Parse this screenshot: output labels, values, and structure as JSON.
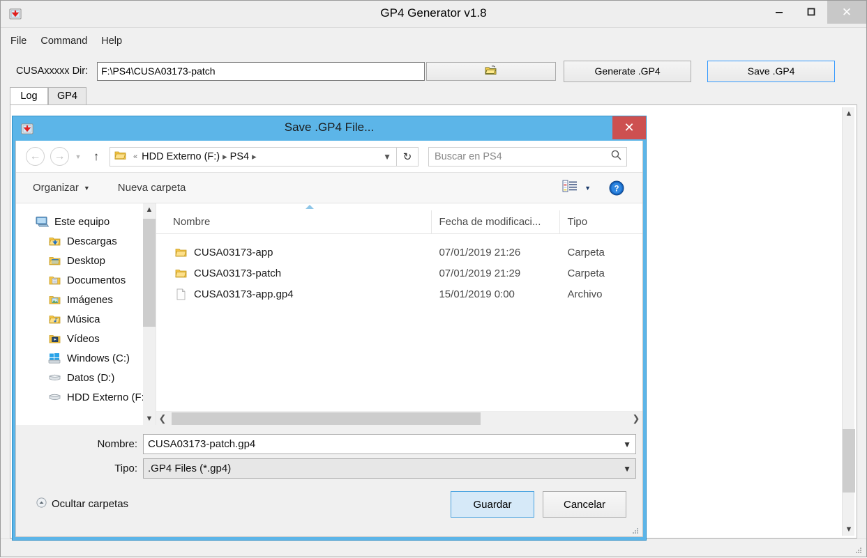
{
  "app": {
    "title": "GP4 Generator v1.8",
    "icon": "save-arrow-icon",
    "window_buttons": {
      "minimize": "—",
      "maximize": "❐",
      "close": "✕"
    },
    "menubar": [
      "File",
      "Command",
      "Help"
    ],
    "path_row": {
      "label": "CUSAxxxxx Dir:",
      "value": "F:\\PS4\\CUSA03173-patch",
      "browse_icon": "open-folder-icon",
      "generate_label": "Generate .GP4",
      "save_label": "Save .GP4"
    },
    "tabs": [
      {
        "label": "Log",
        "active": true
      },
      {
        "label": "GP4",
        "active": false
      }
    ],
    "log_text": ""
  },
  "dialog": {
    "title": "Save .GP4 File...",
    "icon": "save-arrow-icon",
    "close_glyph": "✕",
    "nav": {
      "back_glyph": "←",
      "forward_glyph": "→",
      "history_glyph": "▾",
      "up_glyph": "↑",
      "refresh_glyph": "↻",
      "breadcrumb_prefix": "«",
      "breadcrumb": [
        "HDD Externo (F:)",
        "PS4"
      ],
      "breadcrumb_sep": "▸",
      "dropdown_glyph": "⌄"
    },
    "search": {
      "placeholder": "Buscar en PS4",
      "value": "",
      "icon": "search-icon"
    },
    "command_bar": {
      "organize_label": "Organizar",
      "organize_caret": "▾",
      "new_folder_label": "Nueva carpeta",
      "view_icon": "view-options-icon",
      "view_caret": "▾",
      "help_icon": "help-icon"
    },
    "sidebar": [
      {
        "label": "Este equipo",
        "icon": "computer-icon",
        "level": 0
      },
      {
        "label": "Descargas",
        "icon": "downloads-folder-icon",
        "level": 1
      },
      {
        "label": "Desktop",
        "icon": "desktop-folder-icon",
        "level": 1
      },
      {
        "label": "Documentos",
        "icon": "documents-folder-icon",
        "level": 1
      },
      {
        "label": "Imágenes",
        "icon": "pictures-folder-icon",
        "level": 1
      },
      {
        "label": "Música",
        "icon": "music-folder-icon",
        "level": 1
      },
      {
        "label": "Vídeos",
        "icon": "videos-folder-icon",
        "level": 1
      },
      {
        "label": "Windows (C:)",
        "icon": "windows-drive-icon",
        "level": 1
      },
      {
        "label": "Datos (D:)",
        "icon": "drive-icon",
        "level": 1
      },
      {
        "label": "HDD Externo (F:)",
        "icon": "drive-icon",
        "level": 1
      }
    ],
    "file_list": {
      "columns": [
        "Nombre",
        "Fecha de modificaci...",
        "Tipo"
      ],
      "sort_column": "Nombre",
      "sort_direction": "ascending",
      "rows": [
        {
          "name": "CUSA03173-app",
          "modified": "07/01/2019 21:26",
          "type": "Carpeta",
          "icon": "folder-icon"
        },
        {
          "name": "CUSA03173-patch",
          "modified": "07/01/2019 21:29",
          "type": "Carpeta",
          "icon": "folder-icon"
        },
        {
          "name": "CUSA03173-app.gp4",
          "modified": "15/01/2019 0:00",
          "type": "Archivo",
          "icon": "file-icon"
        }
      ]
    },
    "form": {
      "name_label": "Nombre:",
      "name_value": "CUSA03173-patch.gp4",
      "type_label": "Tipo:",
      "type_value": ".GP4 Files (*.gp4)",
      "combo_caret": "⌄"
    },
    "hide_folders_label": "Ocultar carpetas",
    "hide_folders_icon": "chevron-up-circle-icon",
    "save_button": "Guardar",
    "cancel_button": "Cancelar"
  },
  "colors": {
    "dialog_accent": "#5cb5e8",
    "close_red": "#cd5050",
    "save_highlight": "#3399ff",
    "guardar_bg": "#d6e9f8"
  }
}
